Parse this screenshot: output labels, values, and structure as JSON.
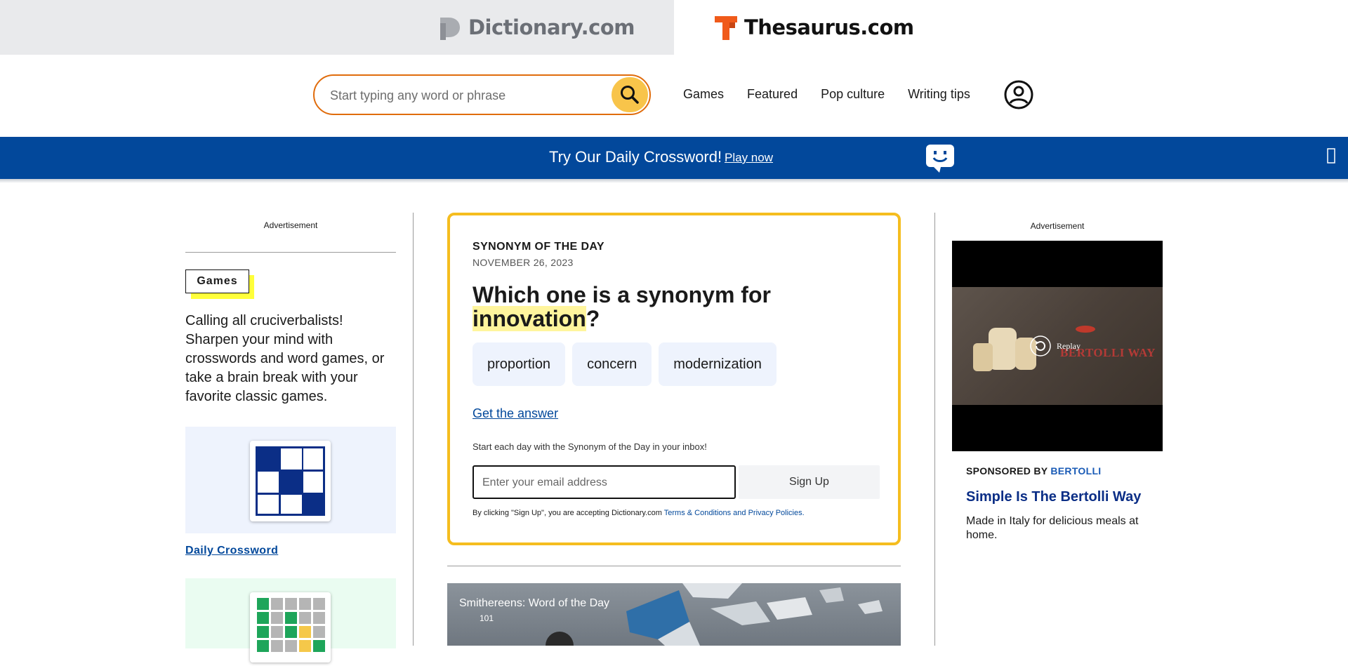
{
  "brand": {
    "dictionary": "Dictionary.com",
    "thesaurus": "Thesaurus.com"
  },
  "search": {
    "placeholder": "Start typing any word or phrase"
  },
  "nav": {
    "items": [
      "Games",
      "Featured",
      "Pop culture",
      "Writing tips"
    ]
  },
  "banner": {
    "text": "Try Our Daily Crossword!",
    "link": "Play now"
  },
  "left": {
    "ad_label": "Advertisement",
    "tag": "Games",
    "description": "Calling all cruciverbalists! Sharpen your mind with crosswords and word games, or take a brain break with your favorite classic games.",
    "tile1_link": "Daily Crossword"
  },
  "sotd": {
    "label": "SYNONYM OF THE DAY",
    "date": "NOVEMBER 26, 2023",
    "question_prefix": "Which one is a synonym for",
    "word": "innovation",
    "question_suffix": "?",
    "choices": [
      "proportion",
      "concern",
      "modernization"
    ],
    "answer_link": "Get the answer",
    "inbox_text": "Start each day with the Synonym of the Day in your inbox!",
    "email_placeholder": "Enter your email address",
    "signup_label": "Sign Up",
    "terms_prefix": "By clicking \"Sign Up\", you are accepting Dictionary.com",
    "terms_link": "Terms & Conditions and Privacy Policies."
  },
  "video": {
    "title": "Smithereens: Word of the Day",
    "sub": "101"
  },
  "right": {
    "ad_label": "Advertisement",
    "ad_frame_text": "BERTOLLI WAY",
    "replay": "Replay",
    "sponsored_prefix": "SPONSORED BY",
    "sponsor": "BERTOLLI",
    "headline": "Simple Is The Bertolli Way",
    "body": "Made in Italy for delicious meals at home."
  },
  "colors": {
    "banner": "#02489b",
    "search_border": "#e06c0c",
    "search_button": "#f8c44a",
    "sotd_border": "#f5bd1f",
    "highlight": "#fff59d",
    "link": "#02489b"
  },
  "icons": [
    "dictionary-logo-icon",
    "thesaurus-logo-icon",
    "search-icon",
    "user-icon",
    "crossword-bubble-icon",
    "close-icon",
    "replay-icon"
  ]
}
